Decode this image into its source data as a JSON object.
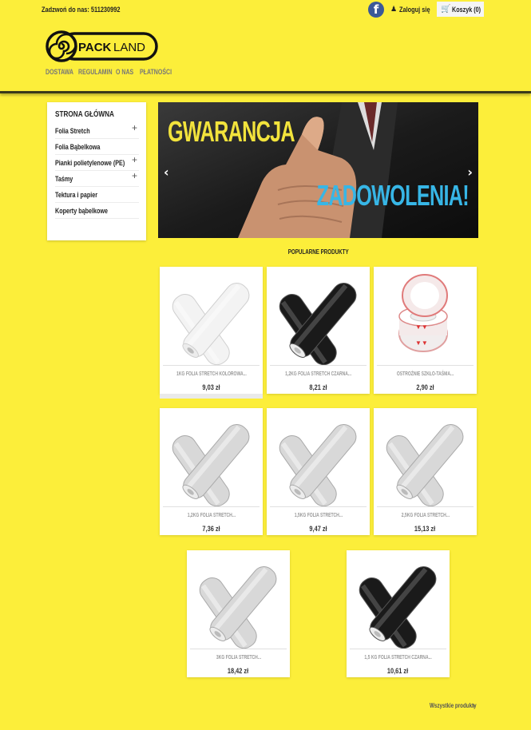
{
  "topbar": {
    "phone_label": "Zadzwoń do nas:",
    "phone_number": "511230992",
    "facebook_icon": "facebook-icon",
    "login_label": "Zaloguj się",
    "cart_label": "Koszyk",
    "cart_count": "(0)"
  },
  "logo": {
    "text_pack": "PACK",
    "text_land": "LAND"
  },
  "nav": [
    "DOSTAWA",
    "REGULAMIN",
    "O NAS",
    "PŁATNOŚCI"
  ],
  "sidebar": {
    "title": "STRONA GŁÓWNA",
    "items": [
      {
        "label": "Folia Stretch",
        "expandable": true
      },
      {
        "label": "Folia Bąbelkowa",
        "expandable": false
      },
      {
        "label": "Pianki polietylenowe (PE)",
        "expandable": true
      },
      {
        "label": "Taśmy",
        "expandable": true
      },
      {
        "label": "Tektura i papier",
        "expandable": false
      },
      {
        "label": "Koperty bąbelkowe",
        "expandable": false
      }
    ]
  },
  "banner": {
    "line1": "GWARANCJA",
    "line2": "ZADOWOLENIA!",
    "prev": "‹",
    "next": "›"
  },
  "section_title": "POPULARNE PRODUKTY",
  "products": [
    {
      "name": "1KG FOLIA STRETCH KOLOROWA...",
      "price": "9,03 zł",
      "image": "white-stretch-film-rolls"
    },
    {
      "name": "1,2KG FOLIA STRETCH CZARNA...",
      "price": "8,21 zł",
      "image": "black-stretch-film-rolls"
    },
    {
      "name": "OSTROŻNIE SZKŁO-TAŚMA...",
      "price": "2,90 zł",
      "image": "fragile-tape-rolls"
    },
    {
      "name": "1,2KG FOLIA STRETCH...",
      "price": "7,36 zł",
      "image": "clear-stretch-film-rolls"
    },
    {
      "name": "1,5KG FOLIA STRETCH...",
      "price": "9,47 zł",
      "image": "clear-stretch-film-rolls"
    },
    {
      "name": "2,5KG FOLIA STRETCH...",
      "price": "15,13 zł",
      "image": "clear-stretch-film-rolls"
    },
    {
      "name": "3KG FOLIA STRETCH...",
      "price": "18,42 zł",
      "image": "clear-stretch-film-rolls"
    },
    {
      "name": "1,5 KG FOLIA STRETCH CZARNA...",
      "price": "10,61 zł",
      "image": "black-stretch-film-rolls"
    }
  ],
  "all_products_link": "Wszystkie produkty",
  "colors": {
    "background": "#fcee3a",
    "banner_yellow": "#f2e33c",
    "banner_blue": "#37b6e6",
    "facebook": "#3b5998"
  }
}
